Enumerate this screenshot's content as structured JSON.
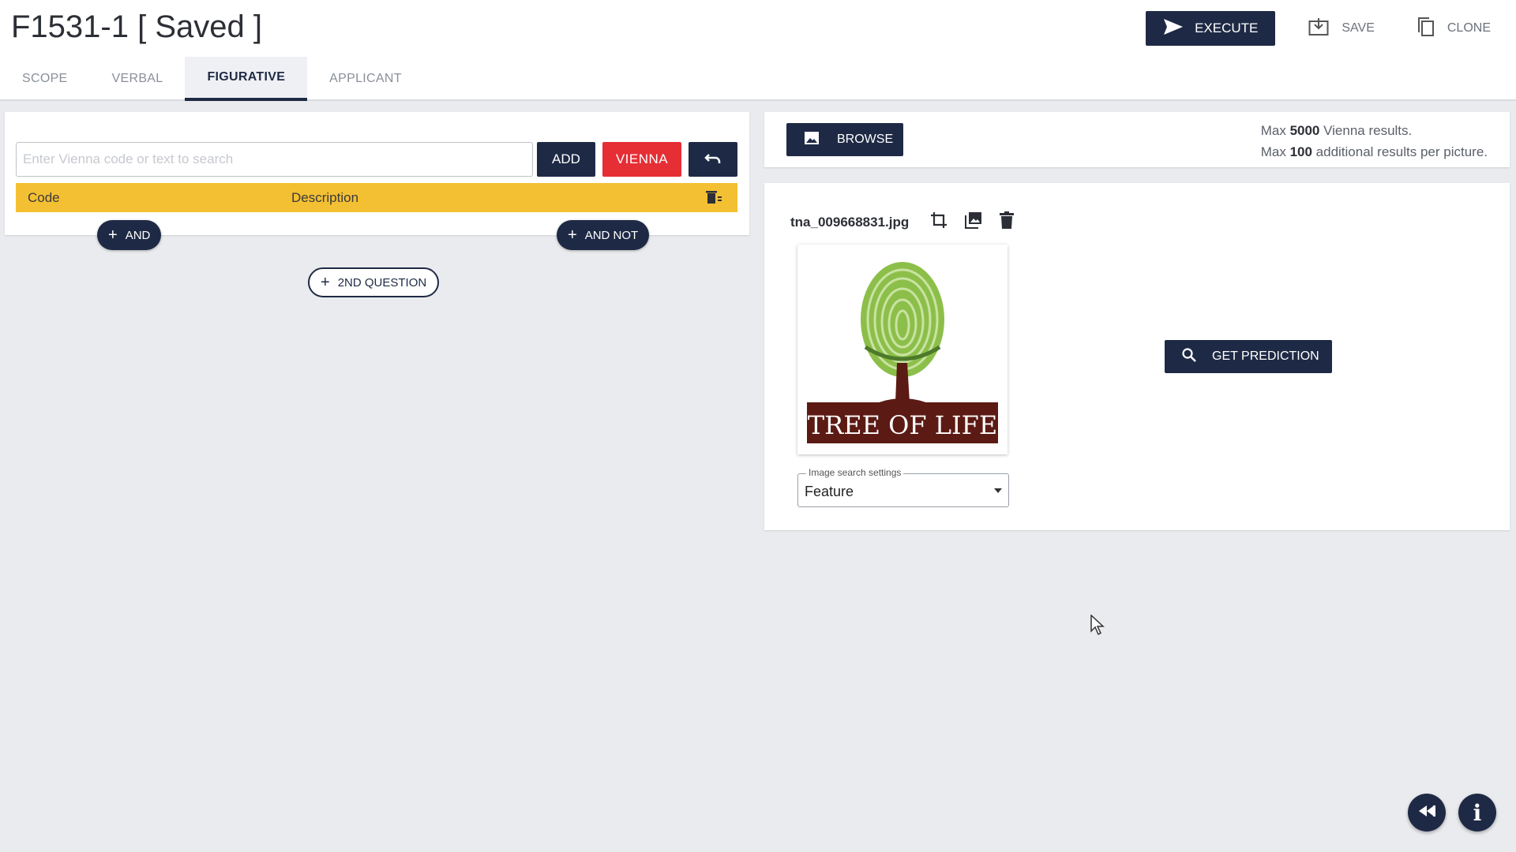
{
  "header": {
    "title": "F1531-1 [ Saved ]",
    "tabs": [
      {
        "label": "SCOPE"
      },
      {
        "label": "VERBAL"
      },
      {
        "label": "FIGURATIVE"
      },
      {
        "label": "APPLICANT"
      }
    ],
    "active_tab": "FIGURATIVE",
    "actions": {
      "execute_label": "EXECUTE",
      "save_label": "SAVE",
      "clone_label": "CLONE"
    }
  },
  "vienna_search": {
    "placeholder": "Enter Vienna code or text to search",
    "value": "",
    "add_label": "ADD",
    "vienna_label": "VIENNA",
    "table": {
      "columns": [
        "Code",
        "Description"
      ],
      "rows": []
    },
    "and_label": "AND",
    "and_not_label": "AND NOT",
    "second_question_label": "2ND QUESTION"
  },
  "image_search": {
    "browse_label": "BROWSE",
    "info_line1_prefix": "Max ",
    "info_line1_value": "5000",
    "info_line1_suffix": " Vienna results.",
    "info_line2_prefix": "Max ",
    "info_line2_value": "100",
    "info_line2_suffix": " additional results per picture.",
    "file_name": "tna_009668831.jpg",
    "logo_text": "TREE OF LIFE",
    "settings_label": "Image search settings",
    "settings_value": "Feature",
    "predict_label": "GET PREDICTION"
  },
  "colors": {
    "primary": "#1e2a45",
    "danger": "#e62e35",
    "table_header": "#f4c033",
    "background": "#eaebee"
  }
}
